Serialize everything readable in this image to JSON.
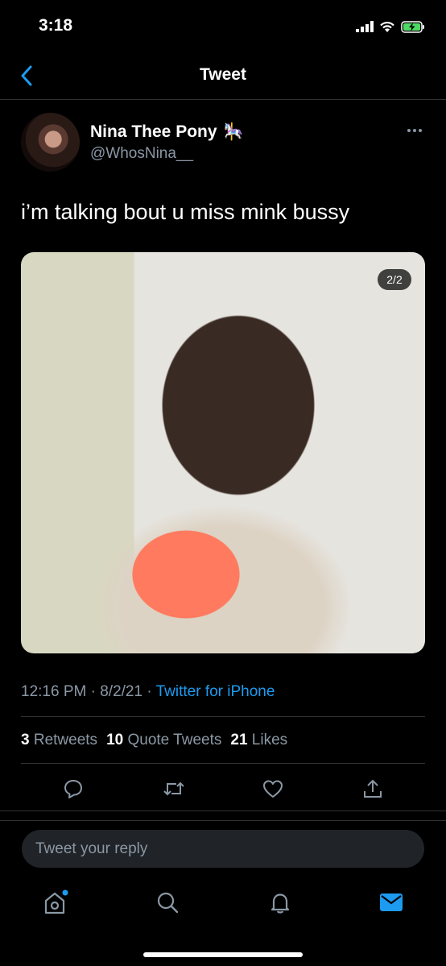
{
  "status_bar": {
    "time": "3:18"
  },
  "nav": {
    "title": "Tweet"
  },
  "tweet": {
    "display_name": "Nina Thee Pony",
    "name_emoji": "🎠",
    "handle": "@WhosNina__",
    "text": "i’m talking bout u miss mink bussy",
    "media_counter": "2/2",
    "time": "12:16 PM",
    "date": "8/2/21",
    "separator": "·",
    "source": "Twitter for iPhone",
    "stats": {
      "retweets_count": "3",
      "retweets_label": "Retweets",
      "quotes_count": "10",
      "quotes_label": "Quote Tweets",
      "likes_count": "21",
      "likes_label": "Likes"
    }
  },
  "reply": {
    "placeholder": "Tweet your reply"
  },
  "icons": {
    "back": "chevron-left-icon",
    "more": "more-horizontal-icon",
    "reply": "comment-icon",
    "retweet": "retweet-icon",
    "like": "heart-icon",
    "share": "share-icon",
    "tab_home": "home-icon",
    "tab_search": "search-icon",
    "tab_notifications": "bell-icon",
    "tab_messages": "mail-icon"
  },
  "colors": {
    "accent": "#1d9bf0",
    "background": "#000000",
    "secondary_text": "#8b98a5",
    "battery_charging": "#4cd964"
  }
}
